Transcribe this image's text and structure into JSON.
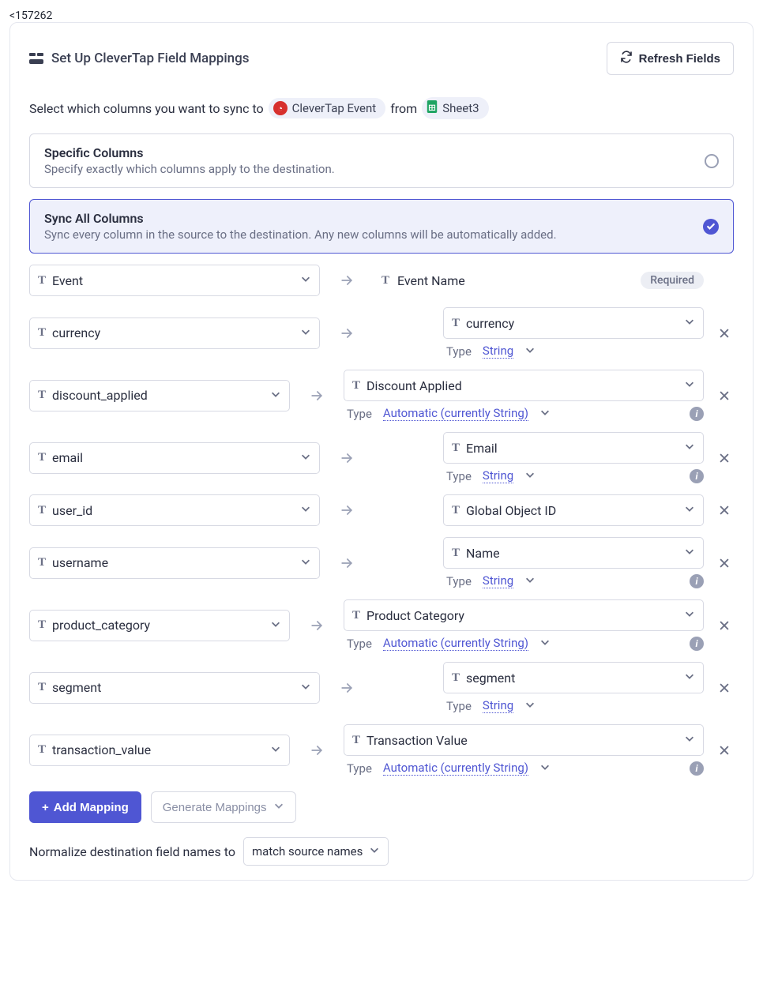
{
  "header": {
    "title": "Set Up CleverTap Field Mappings",
    "refresh_label": "Refresh Fields"
  },
  "description": {
    "prefix": "Select which columns you want to sync to",
    "dest_pill": "CleverTap Event",
    "from_word": "from",
    "src_pill": "Sheet3"
  },
  "options": {
    "specific": {
      "title": "Specific Columns",
      "sub": "Specify exactly which columns apply to the destination."
    },
    "sync_all": {
      "title": "Sync All Columns",
      "sub": "Sync every column in the source to the destination. Any new columns will be automatically added."
    }
  },
  "required_label": "Required",
  "type_label": "Type",
  "type_string": "String",
  "type_auto": "Automatic (currently String)",
  "mappings": [
    {
      "src": "Event",
      "dest": "Event Name",
      "required": true,
      "src_width": "wide",
      "has_type": false,
      "dest_box": false,
      "removable": false
    },
    {
      "src": "currency",
      "dest": "currency",
      "src_width": "wide",
      "has_type": true,
      "type": "String",
      "dest_box": true,
      "removable": true,
      "info": false
    },
    {
      "src": "discount_applied",
      "dest": "Discount Applied",
      "src_width": "narrow",
      "has_type": true,
      "type": "Automatic (currently String)",
      "dest_box": true,
      "removable": true,
      "info": true,
      "dest_wide": true
    },
    {
      "src": "email",
      "dest": "Email",
      "src_width": "wide",
      "has_type": true,
      "type": "String",
      "dest_box": true,
      "removable": true,
      "info": true
    },
    {
      "src": "user_id",
      "dest": "Global Object ID",
      "src_width": "wide",
      "has_type": false,
      "dest_box": true,
      "removable": true
    },
    {
      "src": "username",
      "dest": "Name",
      "src_width": "wide",
      "has_type": true,
      "type": "String",
      "dest_box": true,
      "removable": true,
      "info": true
    },
    {
      "src": "product_category",
      "dest": "Product Category",
      "src_width": "narrow",
      "has_type": true,
      "type": "Automatic (currently String)",
      "dest_box": true,
      "removable": true,
      "info": true,
      "dest_wide": true
    },
    {
      "src": "segment",
      "dest": "segment",
      "src_width": "wide",
      "has_type": true,
      "type": "String",
      "dest_box": true,
      "removable": true,
      "info": false
    },
    {
      "src": "transaction_value",
      "dest": "Transaction Value",
      "src_width": "narrow",
      "has_type": true,
      "type": "Automatic (currently String)",
      "dest_box": true,
      "removable": true,
      "info": true,
      "dest_wide": true
    }
  ],
  "actions": {
    "add_mapping": "Add Mapping",
    "generate": "Generate Mappings"
  },
  "normalize": {
    "label": "Normalize destination field names to",
    "value": "match source names"
  }
}
